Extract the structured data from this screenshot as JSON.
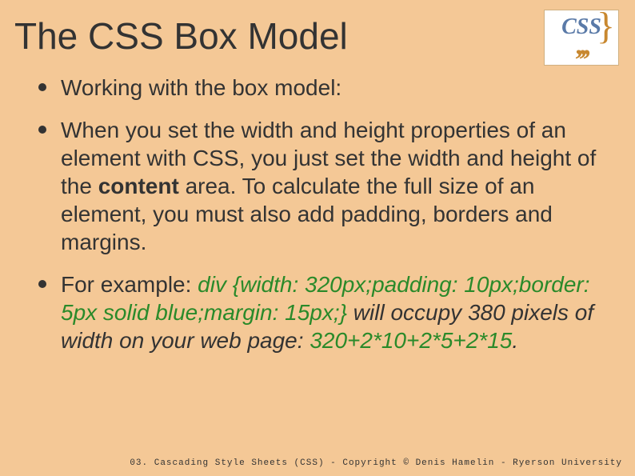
{
  "title": "The CSS Box Model",
  "logo": {
    "text_top": "CSS",
    "text_bottom": ",,,"
  },
  "bullets": {
    "item0": "Working with the box model:",
    "item1_part1": "When you set the width and height properties of an element with CSS, you just set the width and height of the ",
    "item1_bold": "content",
    "item1_part2": " area. To calculate the full size of an element, you must also add padding, borders and margins.",
    "item2_part1": "For example: ",
    "item2_code": "div {width: 320px;padding: 10px;border: 5px solid blue;margin: 15px;}",
    "item2_part2": " will occupy 380 pixels of width on your web page: ",
    "item2_calc": "320+2*10+2*5+2*15",
    "item2_part3": "."
  },
  "footer": "03. Cascading Style Sheets (CSS) - Copyright © Denis Hamelin - Ryerson University"
}
